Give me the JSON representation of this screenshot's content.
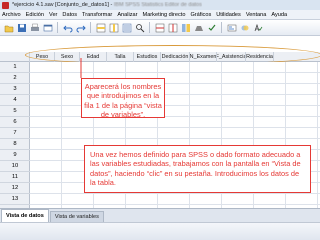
{
  "window": {
    "title_visible": "*ejercicio 4.1.sav [Conjunto_de_datos1] - IBM SPSS Statistics Editor de datos",
    "title_prefix": "*ejercicio 4.1.sav [Conjunto_de_datos1] - ",
    "title_app": "IBM SPSS Statistics Editor de datos"
  },
  "menu": [
    "Archivo",
    "Edición",
    "Ver",
    "Datos",
    "Transformar",
    "Analizar",
    "Marketing directo",
    "Gráficos",
    "Utilidades",
    "Ventana",
    "Ayuda"
  ],
  "toolbar_icons": [
    "open-icon",
    "save-icon",
    "print-icon",
    "recall-dialog-icon",
    "undo-icon",
    "redo-icon",
    "goto-case-icon",
    "goto-variable-icon",
    "variables-icon",
    "find-icon",
    "insert-cases-icon",
    "insert-variable-icon",
    "split-file-icon",
    "weight-cases-icon",
    "select-cases-icon",
    "value-labels-icon",
    "use-sets-icon",
    "spell-icon"
  ],
  "columns": [
    "Peso",
    "Sexo",
    "Edad",
    "Talla",
    "Estudios",
    "Dedicación",
    "N_Examen",
    "F_Asistencia",
    "Residencia"
  ],
  "rows": [
    "1",
    "2",
    "3",
    "4",
    "5",
    "6",
    "7",
    "8",
    "9",
    "10",
    "11",
    "12",
    "13"
  ],
  "callouts": {
    "first": "Aparecerá los nombres que introdujimos en la fila 1 de la página “vista de variables”.",
    "second": "Una vez hemos definido para SPSS o dado formato adecuado a las variables estudiadas, trabajamos con la pantalla en “Vista de datos”, haciendo “clic” en su pestaña. Introducimos los datos de la tabla."
  },
  "tabs": {
    "data_view": "Vista de datos",
    "variable_view": "Vista de variables"
  },
  "colors": {
    "callout_red": "#e53935",
    "highlight_ellipse": "#d99a3a"
  }
}
